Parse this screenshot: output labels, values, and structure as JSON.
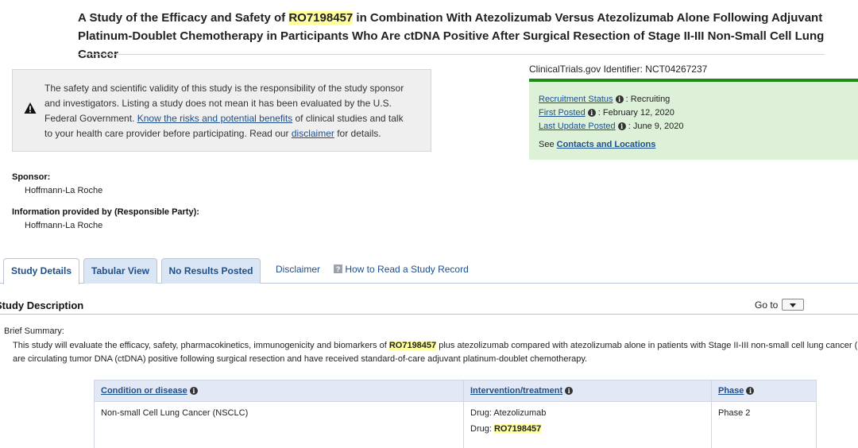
{
  "title": {
    "prefix": "A Study of the Efficacy and Safety of ",
    "drug": "RO7198457",
    "rest": " in Combination With Atezolizumab Versus Atezolizumab Alone Following Adjuvant Platinum-Doublet Chemotherapy in Participants Who Are ctDNA Positive After Surgical Resection of Stage II-III Non-Small Cell Lung Cancer"
  },
  "disclaimer_box": {
    "icon": "warning-icon",
    "text_1": "The safety and scientific validity of this study is the responsibility of the study sponsor and investigators. Listing a study does not mean it has been evaluated by the U.S. Federal Government. ",
    "risks_link": "Know the risks and potential benefits",
    "text_2": " of clinical studies and talk to your health care provider before participating. Read our ",
    "disclaimer_link": "disclaimer",
    "text_3": " for details."
  },
  "identifier": "ClinicalTrials.gov Identifier: NCT04267237",
  "status": {
    "recruitment_label": "Recruitment Status",
    "recruitment_value": " : Recruiting",
    "first_posted_label": "First Posted",
    "first_posted_value": " : February 12, 2020",
    "last_update_label": "Last Update Posted",
    "last_update_value": " : June 9, 2020",
    "see": "See ",
    "contacts_link": "Contacts and Locations",
    "accent": "#1f8a16"
  },
  "sponsor": {
    "label": "Sponsor:",
    "value": "Hoffmann-La Roche",
    "info_label": "Information provided by (Responsible Party):",
    "info_value": "Hoffmann-La Roche"
  },
  "tabs": {
    "study_details": "Study Details",
    "tabular_view": "Tabular View",
    "no_results": "No Results Posted",
    "disclaimer": "Disclaimer",
    "how_to_read": "How to Read a Study Record"
  },
  "study_description": {
    "title": "Study Description",
    "goto": "Go to",
    "brief_label": "Brief Summary:",
    "brief_line1_a": "This study will evaluate the efficacy, safety, pharmacokinetics, immunogenicity and biomarkers of ",
    "brief_drug": "RO7198457",
    "brief_line1_b": " plus atezolizumab compared with atezolizumab alone in patients with Stage II-III non-small cell lung cancer (N",
    "brief_line2": "are circulating tumor DNA (ctDNA) positive following surgical resection and have received standard-of-care adjuvant platinum-doublet chemotherapy."
  },
  "table": {
    "headers": [
      "Condition or disease",
      "Intervention/treatment",
      "Phase"
    ],
    "condition": "Non-small Cell Lung Cancer (NSCLC)",
    "intervention_1": "Drug: Atezolizumab",
    "intervention_2_prefix": "Drug: ",
    "intervention_2_drug": "RO7198457",
    "phase": "Phase 2"
  }
}
